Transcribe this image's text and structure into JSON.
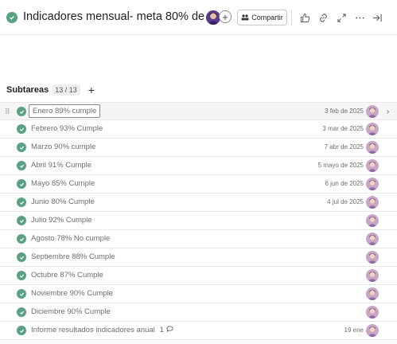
{
  "header": {
    "task_title": "Indicadores mensual- meta 80% de fac...",
    "share_label": "Compartir",
    "icons": [
      "thumbs-up-icon",
      "link-icon",
      "expand-icon",
      "more-icon",
      "close-panel-icon"
    ]
  },
  "subtasks": {
    "heading": "Subtareas",
    "count": "13 / 13",
    "add_label": "+",
    "items": [
      {
        "label": "Enero 89% cumple",
        "date": "3 feb de 2025"
      },
      {
        "label": "Febrero 93% Cumple",
        "date": "3 mar de 2025"
      },
      {
        "label": "Marzo 90% cumple",
        "date": "7 abr de 2025"
      },
      {
        "label": "Abril 91% Cumple",
        "date": "5 mayo de 2025"
      },
      {
        "label": "Mayo 85% Cumple",
        "date": "6 jun de 2025"
      },
      {
        "label": "Junio 80% Cumple",
        "date": "4 jul de 2025"
      },
      {
        "label": "Julio 92% Cumple",
        "date": ""
      },
      {
        "label": "Agosto 78% No cumple",
        "date": ""
      },
      {
        "label": "Septiembre 88% Cumple",
        "date": ""
      },
      {
        "label": "Octubre 87% Cumple",
        "date": ""
      },
      {
        "label": "Noviembre 90% Cumple",
        "date": ""
      },
      {
        "label": "Diciembre 90% Cumple",
        "date": ""
      },
      {
        "label": "Informe resultados indicadores anual",
        "date": "19 ene",
        "comments": "1"
      }
    ]
  },
  "colors": {
    "complete": "#58a182",
    "avatar": "#c7a7c4",
    "header_avatar": "#5b3a8e"
  }
}
